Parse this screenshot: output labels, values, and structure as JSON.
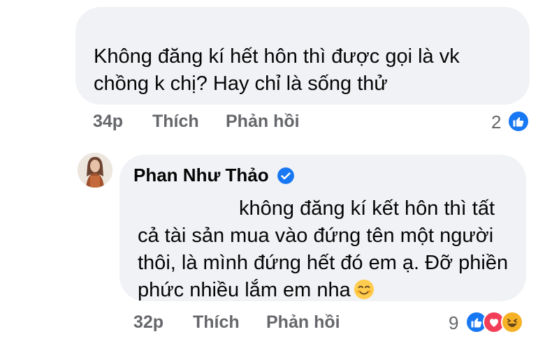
{
  "comment1": {
    "text": "Không đăng kí hết hôn thì được gọi là vk chồng k chị? Hay chỉ là sống thử",
    "time": "34p",
    "like_label": "Thích",
    "reply_label": "Phản hồi",
    "reaction_count": "2",
    "reactions": [
      "like-icon"
    ]
  },
  "comment2": {
    "author": "Phan Như Thảo",
    "verified": true,
    "text": "                  không đăng kí kết hôn thì tất cả tài sản mua vào đứng tên một người thôi, là mình đứng hết đó em ạ. Đỡ phiền phức nhiều lắm em nha",
    "emoji": "smiling-face-icon",
    "time": "32p",
    "like_label": "Thích",
    "reply_label": "Phản hồi",
    "reaction_count": "9",
    "reactions": [
      "like-icon",
      "love-icon",
      "haha-icon"
    ]
  },
  "colors": {
    "bubble": "#f0f2f5",
    "meta_text": "#65676b",
    "like_blue": "#1877f2",
    "love_red": "#f33e58",
    "haha_yellow": "#f7b125"
  }
}
